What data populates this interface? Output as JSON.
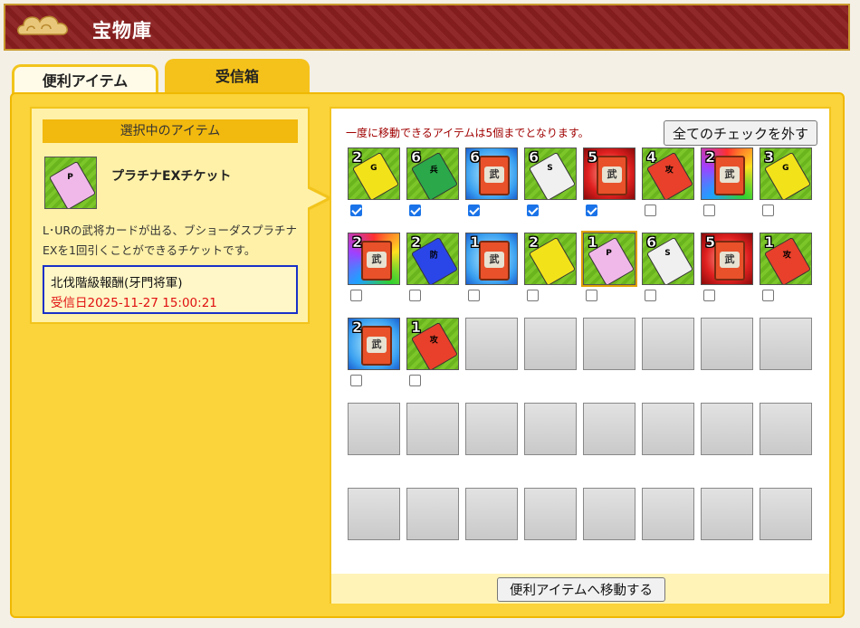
{
  "header": {
    "title": "宝物庫"
  },
  "tabs": [
    {
      "label": "便利アイテム",
      "active": false
    },
    {
      "label": "受信箱",
      "active": true
    }
  ],
  "selected": {
    "heading": "選択中のアイテム",
    "name": "プラチナEXチケット",
    "description": "L･URの武将カードが出る、ブショーダスプラチナEXを1回引くことができるチケットです。",
    "source": "北伐階級報酬(牙門将軍)",
    "received": "受信日2025-11-27 15:00:21"
  },
  "inbox": {
    "notice": "一度に移動できるアイテムは5個までとなります。",
    "uncheck_label": "全てのチェックを外す",
    "move_label": "便利アイテムへ移動する",
    "items": [
      {
        "count": "2",
        "kind": "ticket",
        "color": "#f2e21a",
        "letter": "G",
        "checked": true
      },
      {
        "count": "6",
        "kind": "ticket",
        "color": "#2aa84a",
        "letter": "兵",
        "checked": true
      },
      {
        "count": "6",
        "kind": "card",
        "bg": "blue",
        "checked": true
      },
      {
        "count": "6",
        "kind": "ticket",
        "color": "#f0f0f0",
        "letter": "S",
        "checked": true
      },
      {
        "count": "5",
        "kind": "card",
        "bg": "red",
        "checked": true
      },
      {
        "count": "4",
        "kind": "ticket",
        "color": "#e8402a",
        "letter": "攻",
        "checked": false
      },
      {
        "count": "2",
        "kind": "card",
        "bg": "rainbow",
        "checked": false
      },
      {
        "count": "3",
        "kind": "ticket",
        "color": "#f2e21a",
        "letter": "G",
        "checked": false
      },
      {
        "count": "2",
        "kind": "card",
        "bg": "rainbow",
        "checked": false
      },
      {
        "count": "2",
        "kind": "ticket",
        "color": "#2a46e8",
        "letter": "防",
        "checked": false
      },
      {
        "count": "1",
        "kind": "card",
        "bg": "blue",
        "checked": false
      },
      {
        "count": "2",
        "kind": "ticket",
        "color": "#f2e21a",
        "letter": "",
        "checked": false
      },
      {
        "count": "1",
        "kind": "ticket",
        "color": "#f0b8e8",
        "letter": "P",
        "checked": false,
        "selected": true
      },
      {
        "count": "6",
        "kind": "ticket",
        "color": "#f0f0f0",
        "letter": "S",
        "checked": false
      },
      {
        "count": "5",
        "kind": "card",
        "bg": "red",
        "checked": false
      },
      {
        "count": "1",
        "kind": "ticket",
        "color": "#e8402a",
        "letter": "攻",
        "checked": false
      },
      {
        "count": "2",
        "kind": "card",
        "bg": "blue",
        "checked": false
      },
      {
        "count": "1",
        "kind": "ticket",
        "color": "#e8402a",
        "letter": "攻",
        "checked": false
      }
    ],
    "total_slots": 40
  }
}
